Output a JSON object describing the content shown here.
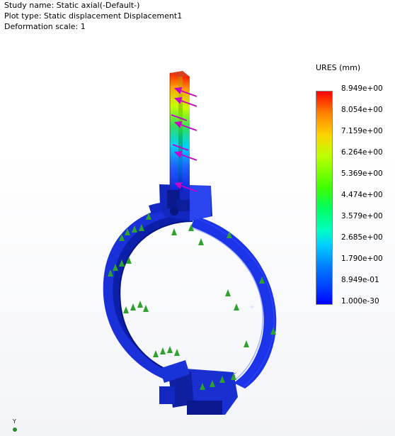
{
  "header": {
    "study": "Study name: Static axial(-Default-)",
    "plot_type": "Plot type: Static displacement Displacement1",
    "deformation": "Deformation scale: 1"
  },
  "legend": {
    "title": "URES (mm)",
    "labels": [
      "8.949e+00",
      "8.054e+00",
      "7.159e+00",
      "6.264e+00",
      "5.369e+00",
      "4.474e+00",
      "3.579e+00",
      "2.685e+00",
      "1.790e+00",
      "8.949e-01",
      "1.000e-30"
    ],
    "colors": {
      "max": "#ff0000",
      "high": "#ffa000",
      "mid": "#00ff00",
      "low": "#00ffff",
      "min": "#0000ff"
    }
  },
  "triad": {
    "axis_label": "Y"
  },
  "colors": {
    "part": "#1a2fe0",
    "fixture": "#2fa12f",
    "load": "#c800c8"
  }
}
